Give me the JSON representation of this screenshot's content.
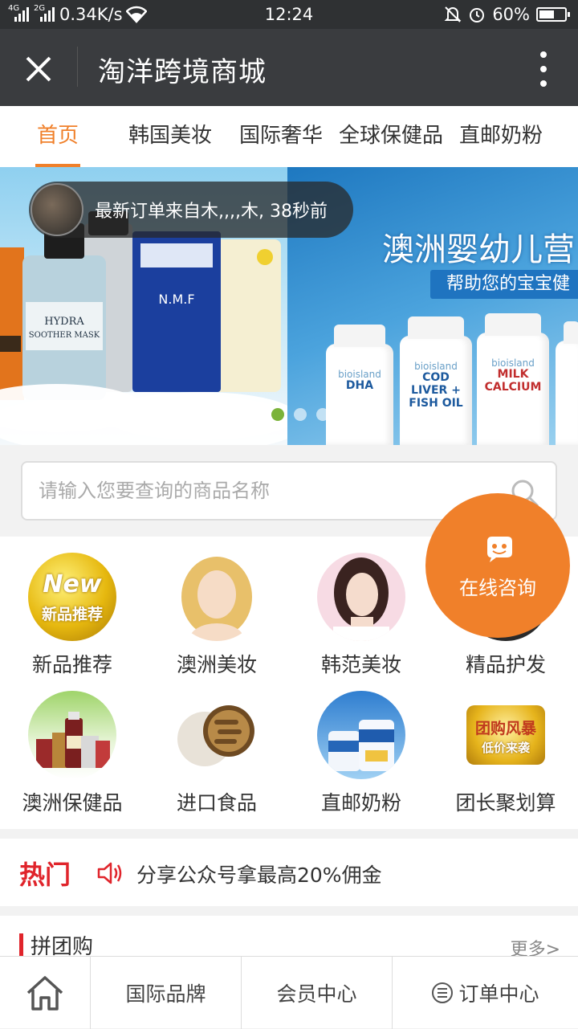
{
  "status_bar": {
    "signal1_label": "4G",
    "signal2_label": "2G",
    "speed": "0.34K/s",
    "time": "12:24",
    "battery": "60%",
    "battery_level": 0.6
  },
  "header": {
    "title": "淘洋跨境商城"
  },
  "tabs": [
    {
      "label": "首页",
      "active": true
    },
    {
      "label": "韩国美妆"
    },
    {
      "label": "国际奢华"
    },
    {
      "label": "全球保健品"
    },
    {
      "label": "直邮奶粉"
    }
  ],
  "banner": {
    "notice": "最新订单来自木,,,,木, 38秒前",
    "slide2_title": "澳洲婴幼儿营",
    "slide2_subtitle": "帮助您的宝宝健",
    "bottles": [
      {
        "brand": "bioisland",
        "name": "DHA"
      },
      {
        "brand": "bioisland",
        "name": "COD LIVER + FISH OIL"
      },
      {
        "brand": "bioisland",
        "name": "MILK CALCIUM"
      }
    ],
    "current_slide": 1
  },
  "search": {
    "placeholder": "请输入您要查询的商品名称",
    "value": ""
  },
  "categories": [
    {
      "label": "新品推荐",
      "icon": "new-badge-icon"
    },
    {
      "label": "澳洲美妆",
      "icon": "woman-portrait-icon"
    },
    {
      "label": "韩范美妆",
      "icon": "woman-portrait-icon"
    },
    {
      "label": "精品护发",
      "icon": "hair-care-icon"
    },
    {
      "label": "澳洲保健品",
      "icon": "supplements-icon"
    },
    {
      "label": "进口食品",
      "icon": "food-icon"
    },
    {
      "label": "直邮奶粉",
      "icon": "milk-powder-icon"
    },
    {
      "label": "团长聚划算",
      "icon": "group-deal-icon"
    }
  ],
  "new_badge": {
    "top": "New",
    "bottom": "新品推荐"
  },
  "group_deal_badge": {
    "top": "团购风暴",
    "bottom": "低价来袭"
  },
  "consult": {
    "label": "在线咨询"
  },
  "hot": {
    "label": "热门",
    "message": "分享公众号拿最高20%佣金"
  },
  "group_buy": {
    "title": "拼团购",
    "more": "更多>"
  },
  "bottom_nav": [
    {
      "label": "",
      "icon": "home-icon"
    },
    {
      "label": "国际品牌"
    },
    {
      "label": "会员中心"
    },
    {
      "label": "订单中心",
      "icon": "list-circle-icon"
    }
  ],
  "colors": {
    "accent": "#f0802a",
    "hot_red": "#e0242b",
    "title_bar": "#3a3c3f"
  }
}
